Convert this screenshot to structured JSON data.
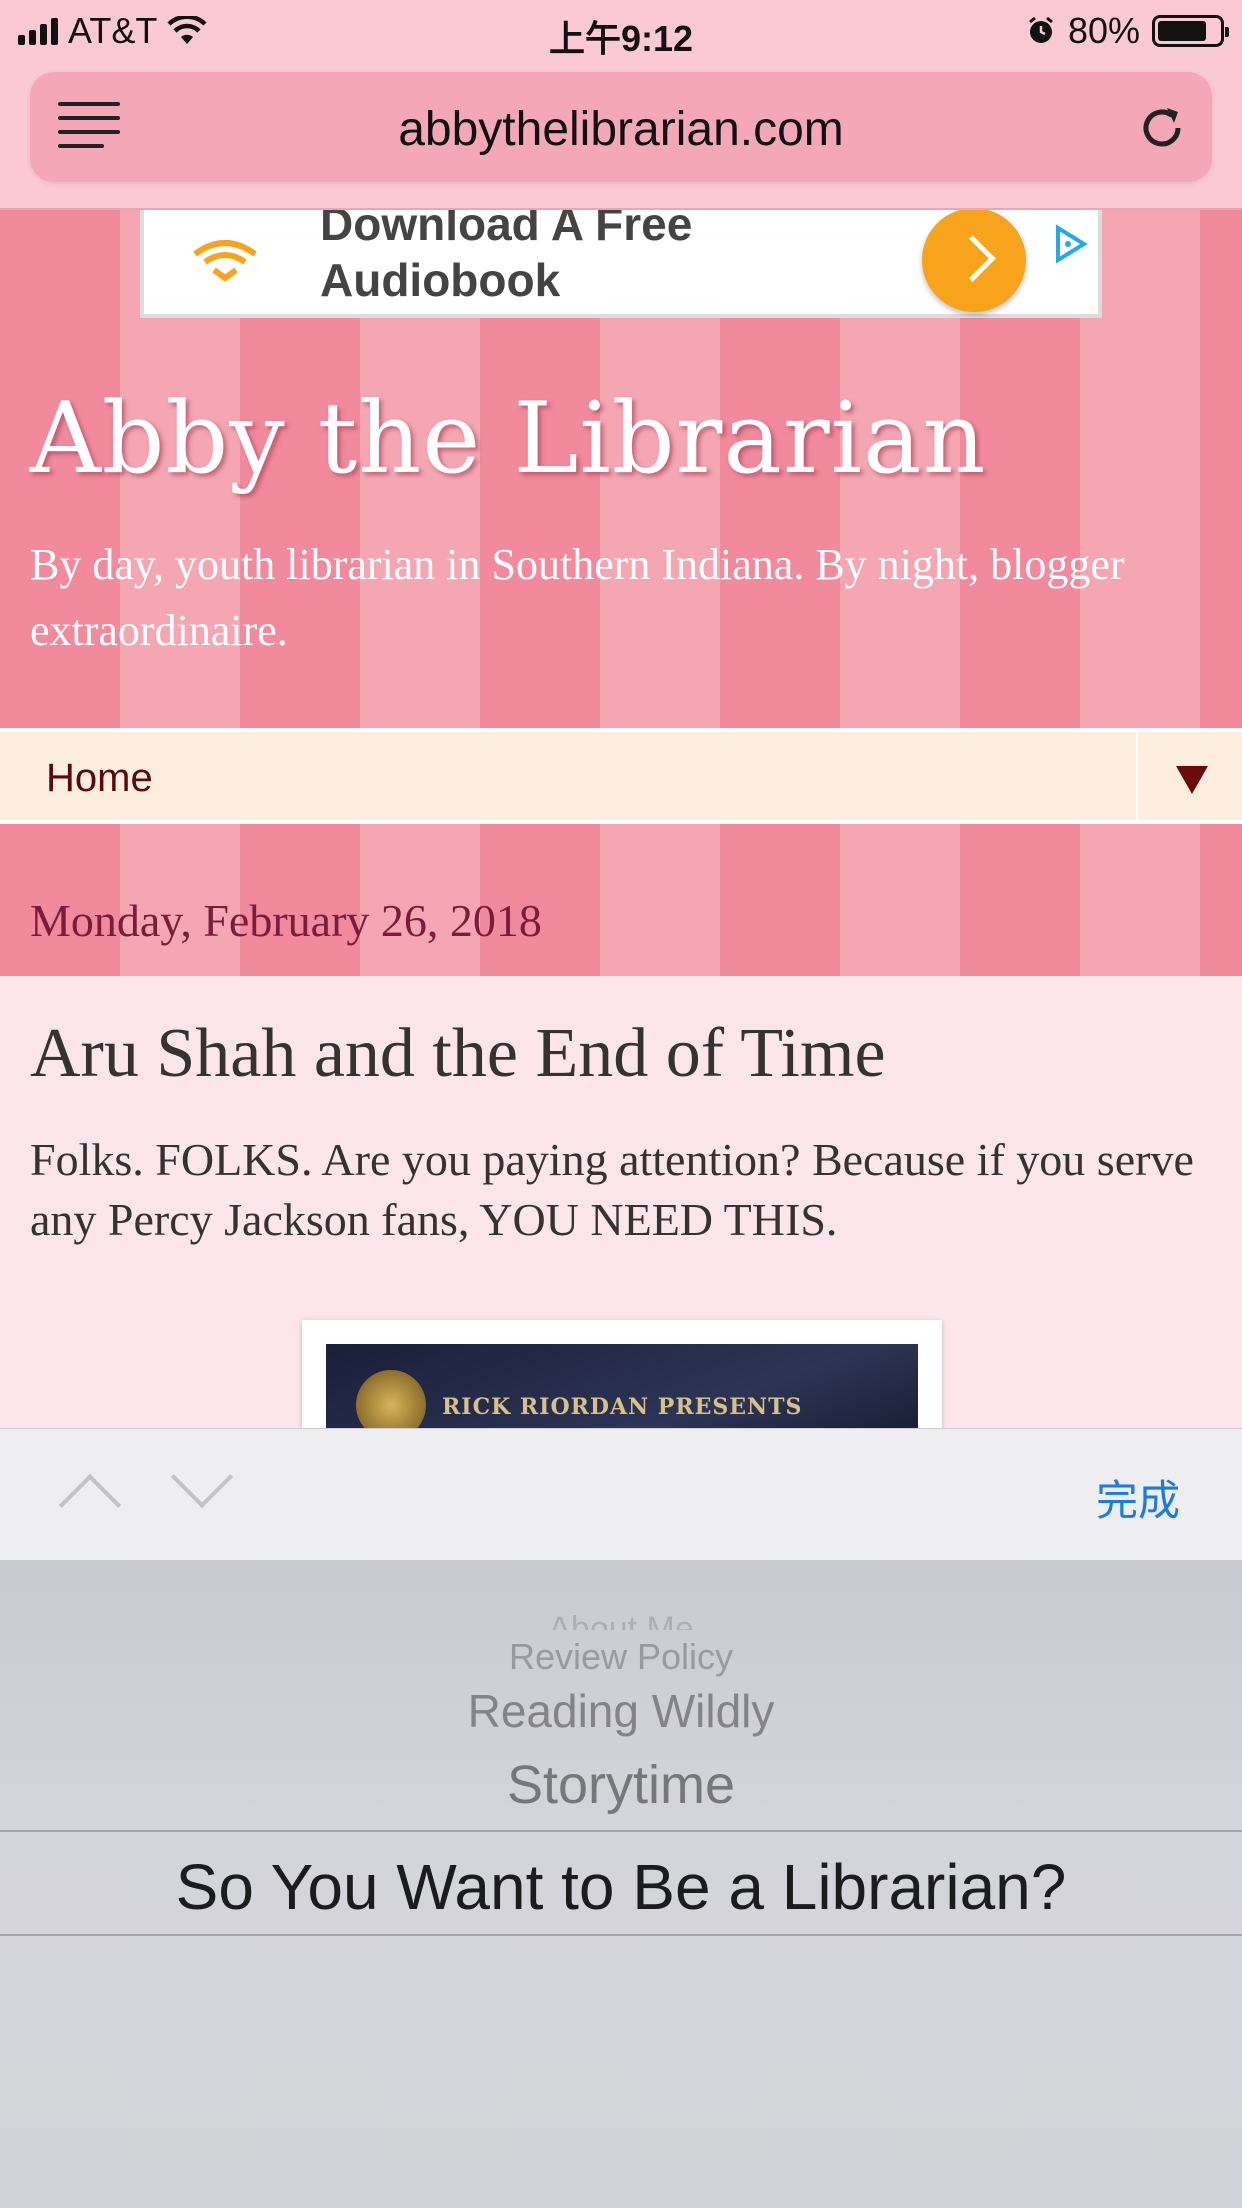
{
  "status_bar": {
    "carrier": "AT&T",
    "time": "上午9:12",
    "battery_percent": "80%",
    "battery_level": 0.8
  },
  "browser": {
    "url": "abbythelibrarian.com"
  },
  "ad": {
    "text_line1": "Download A Free",
    "text_line2": "Audiobook",
    "brand_color": "#f7a31c"
  },
  "blog": {
    "title": "Abby the Librarian",
    "description": "By day, youth librarian in Southern Indiana. By night, blogger extraordinaire."
  },
  "nav": {
    "selected": "Home"
  },
  "post": {
    "date": "Monday, February 26, 2018",
    "title": "Aru Shah and the End of Time",
    "body": "Folks. FOLKS. Are you paying attention? Because if you serve any Percy Jackson fans, YOU NEED THIS.",
    "cover_text": "RICK RIORDAN PRESENTS"
  },
  "picker": {
    "done_label": "完成",
    "options": [
      "About Me",
      "Review Policy",
      "Reading Wildly",
      "Storytime",
      "So You Want to Be a Librarian?"
    ],
    "selected_index": 4
  },
  "colors": {
    "accent_link": "#1a7be0",
    "nav_text": "#5a0a0a",
    "date_text": "#7a1d3a"
  }
}
